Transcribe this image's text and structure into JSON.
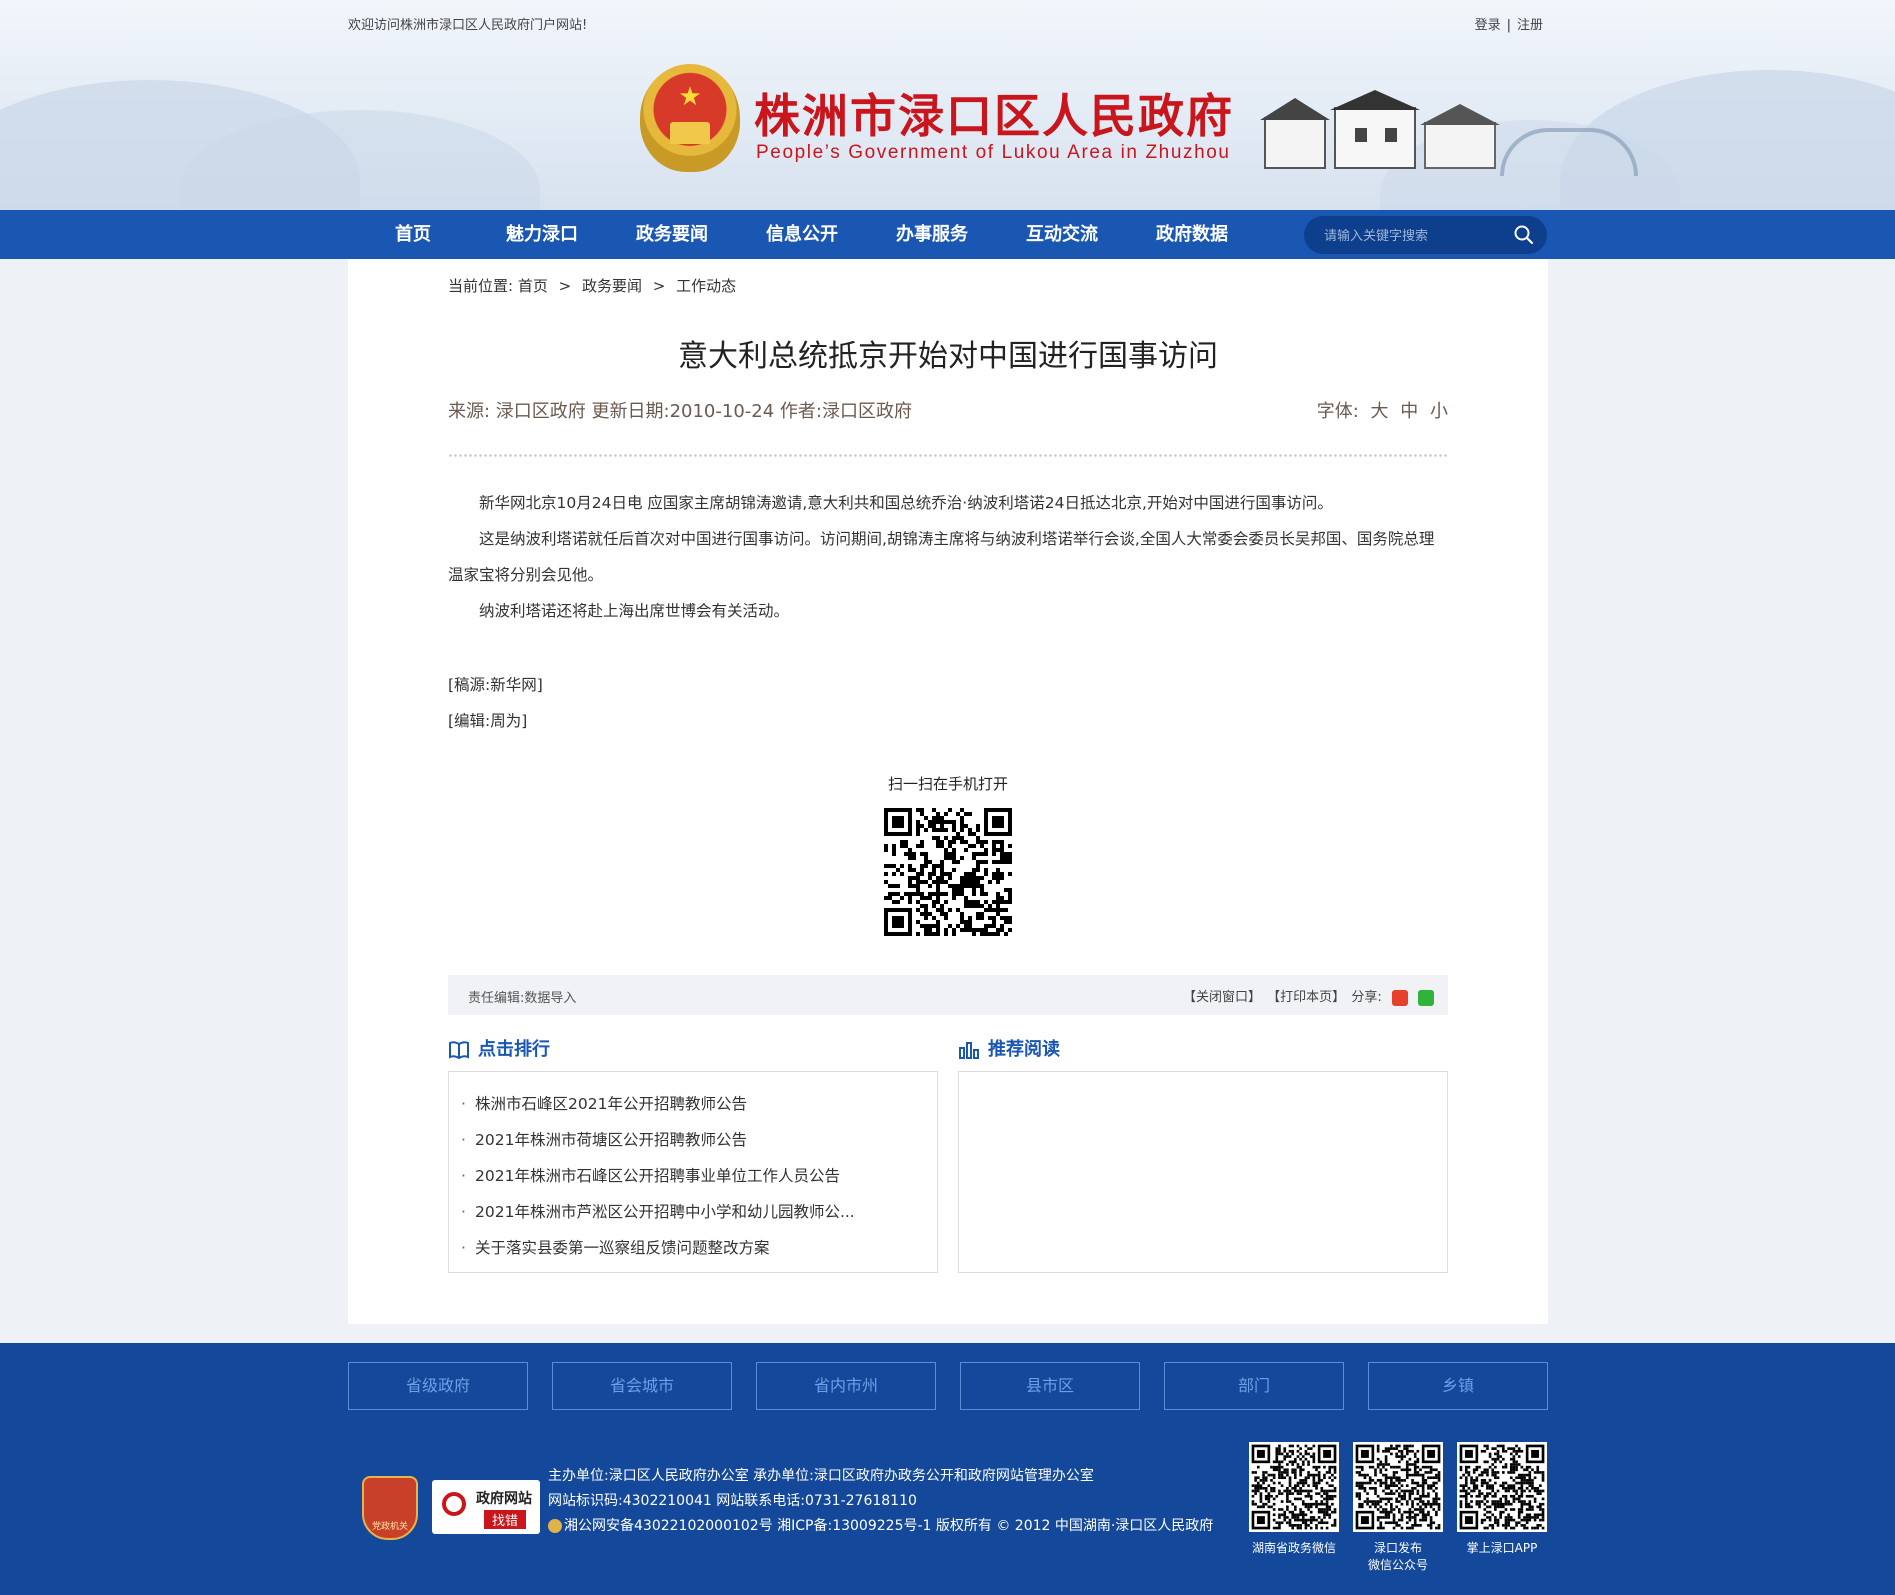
{
  "top": {
    "welcome": "欢迎访问株洲市渌口区人民政府门户网站!",
    "login": "登录",
    "separator": "|",
    "register": "注册"
  },
  "site": {
    "title": "株洲市渌口区人民政府",
    "subtitle": "People’s Government of Lukou Area in Zhuzhou"
  },
  "nav": {
    "items": [
      "首页",
      "魅力渌口",
      "政务要闻",
      "信息公开",
      "办事服务",
      "互动交流",
      "政府数据"
    ],
    "search_placeholder": "请输入关键字搜索"
  },
  "breadcrumb": {
    "prefix": "当前位置:",
    "items": [
      "首页",
      "政务要闻",
      "工作动态"
    ],
    "sep": ">"
  },
  "article": {
    "title": "意大利总统抵京开始对中国进行国事访问",
    "meta": "来源:  渌口区政府 更新日期:2010-10-24 作者:渌口区政府",
    "font_label": "字体:",
    "font_sizes": [
      "大",
      "中",
      "小"
    ],
    "paragraphs": [
      "新华网北京10月24日电 应国家主席胡锦涛邀请,意大利共和国总统乔治·纳波利塔诺24日抵达北京,开始对中国进行国事访问。",
      "这是纳波利塔诺就任后首次对中国进行国事访问。访问期间,胡锦涛主席将与纳波利塔诺举行会谈,全国人大常委会委员长吴邦国、国务院总理温家宝将分别会见他。",
      "纳波利塔诺还将赴上海出席世博会有关活动。"
    ],
    "source_line": "[稿源:新华网]",
    "editor_line": "[编辑:周为]",
    "qr_caption": "扫一扫在手机打开"
  },
  "toolbar": {
    "editor": "责任编辑:数据导入",
    "close": "【关闭窗口】",
    "print": "【打印本页】",
    "share": "分享:"
  },
  "ranking": {
    "title": "点击排行",
    "items": [
      "株洲市石峰区2021年公开招聘教师公告",
      "2021年株洲市荷塘区公开招聘教师公告",
      "2021年株洲市石峰区公开招聘事业单位工作人员公告",
      "2021年株洲市芦淞区公开招聘中小学和幼儿园教师公...",
      "关于落实县委第一巡察组反馈问题整改方案"
    ]
  },
  "recommend": {
    "title": "推荐阅读"
  },
  "footer": {
    "links": [
      "省级政府",
      "省会城市",
      "省内市州",
      "县市区",
      "部门",
      "乡镇"
    ],
    "line1": "主办单位:渌口区人民政府办公室 承办单位:渌口区政府办政务公开和政府网站管理办公室",
    "line2": "网站标识码:4302210041 网站联系电话:0731-27618110",
    "line3": "湘公网安备43022102000102号 湘ICP备:13009225号-1 版权所有 © 2012 中国湖南·渌口区人民政府",
    "party_badge": "党政机关",
    "err_badge_top": "政府网站",
    "err_badge_bottom": "找错",
    "qr_captions": [
      "湖南省政务微信",
      "渌口发布\n微信公众号",
      "掌上渌口APP"
    ]
  }
}
